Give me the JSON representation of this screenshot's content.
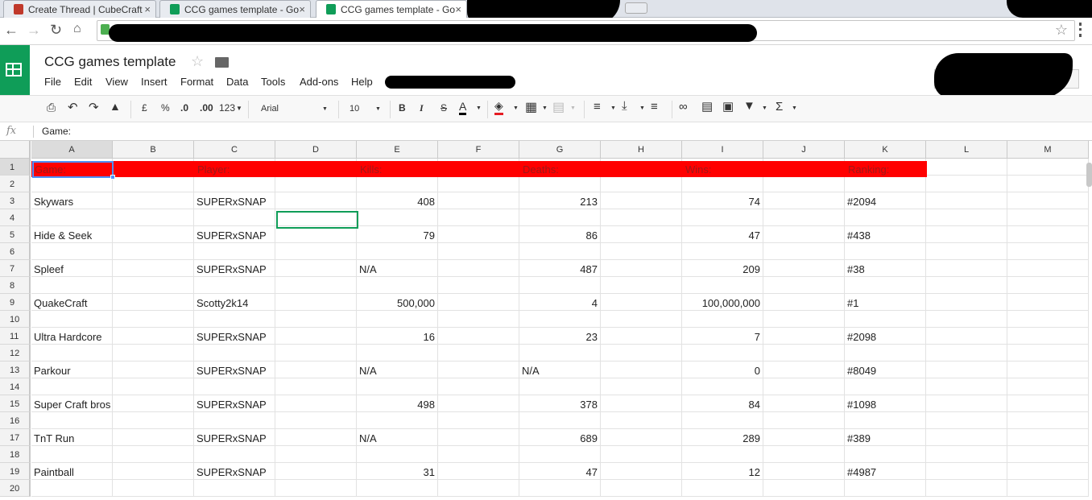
{
  "browser": {
    "tabs": [
      {
        "title": "Create Thread | CubeCraft",
        "icon_color": "#c0392b",
        "active": false
      },
      {
        "title": "CCG games template - Go",
        "icon_color": "#0f9d58",
        "active": false
      },
      {
        "title": "CCG games template - Go",
        "icon_color": "#0f9d58",
        "active": true
      }
    ],
    "close_glyph": "×"
  },
  "doc": {
    "title": "CCG games template",
    "menu": [
      "File",
      "Edit",
      "View",
      "Insert",
      "Format",
      "Data",
      "Tools",
      "Add-ons",
      "Help"
    ]
  },
  "toolbar": {
    "currency": "£",
    "percent": "%",
    "dec_decrease": ".0",
    "dec_increase": ".00",
    "format_more": "123",
    "font": "Arial",
    "font_size": "10",
    "bold": "B",
    "italic": "I",
    "strike": "S",
    "text_color_letter": "A",
    "sum": "Σ"
  },
  "formula": {
    "fx": "fx",
    "value": "Game:"
  },
  "grid": {
    "columns": [
      "A",
      "B",
      "C",
      "D",
      "E",
      "F",
      "G",
      "H",
      "I",
      "J",
      "K",
      "L",
      "M"
    ],
    "header_row": {
      "A": "Game:",
      "C": "Player:",
      "E": "Kills:",
      "G": "Deaths:",
      "I": "Wins:",
      "K": "Ranking:"
    },
    "rows": [
      {
        "row": 3,
        "A": "Skywars",
        "C": "SUPERxSNAP",
        "E": "408",
        "G": "213",
        "I": "74",
        "K": "#2094"
      },
      {
        "row": 5,
        "A": "Hide & Seek",
        "C": "SUPERxSNAP",
        "E": "79",
        "G": "86",
        "I": "47",
        "K": "#438"
      },
      {
        "row": 7,
        "A": "Spleef",
        "C": "SUPERxSNAP",
        "E": "N/A",
        "G": "487",
        "I": "209",
        "K": "#38"
      },
      {
        "row": 9,
        "A": "QuakeCraft",
        "C": "Scotty2k14",
        "E": "500,000",
        "G": "4",
        "I": "100,000,000",
        "K": "#1"
      },
      {
        "row": 11,
        "A": "Ultra Hardcore",
        "C": "SUPERxSNAP",
        "E": "16",
        "G": "23",
        "I": "7",
        "K": "#2098"
      },
      {
        "row": 13,
        "A": "Parkour",
        "C": "SUPERxSNAP",
        "E": "N/A",
        "G": "N/A",
        "I": "0",
        "K": "#8049"
      },
      {
        "row": 15,
        "A": "Super Craft bros",
        "C": "SUPERxSNAP",
        "E": "498",
        "G": "378",
        "I": "84",
        "K": "#1098"
      },
      {
        "row": 17,
        "A": "TnT Run",
        "C": "SUPERxSNAP",
        "E": "N/A",
        "G": "689",
        "I": "289",
        "K": "#389"
      },
      {
        "row": 19,
        "A": "Paintball",
        "C": "SUPERxSNAP",
        "E": "31",
        "G": "47",
        "I": "12",
        "K": "#4987"
      }
    ],
    "header_fill": "#ff0000",
    "header_text_color": "#9a1a1a",
    "active_cell": "A1"
  }
}
